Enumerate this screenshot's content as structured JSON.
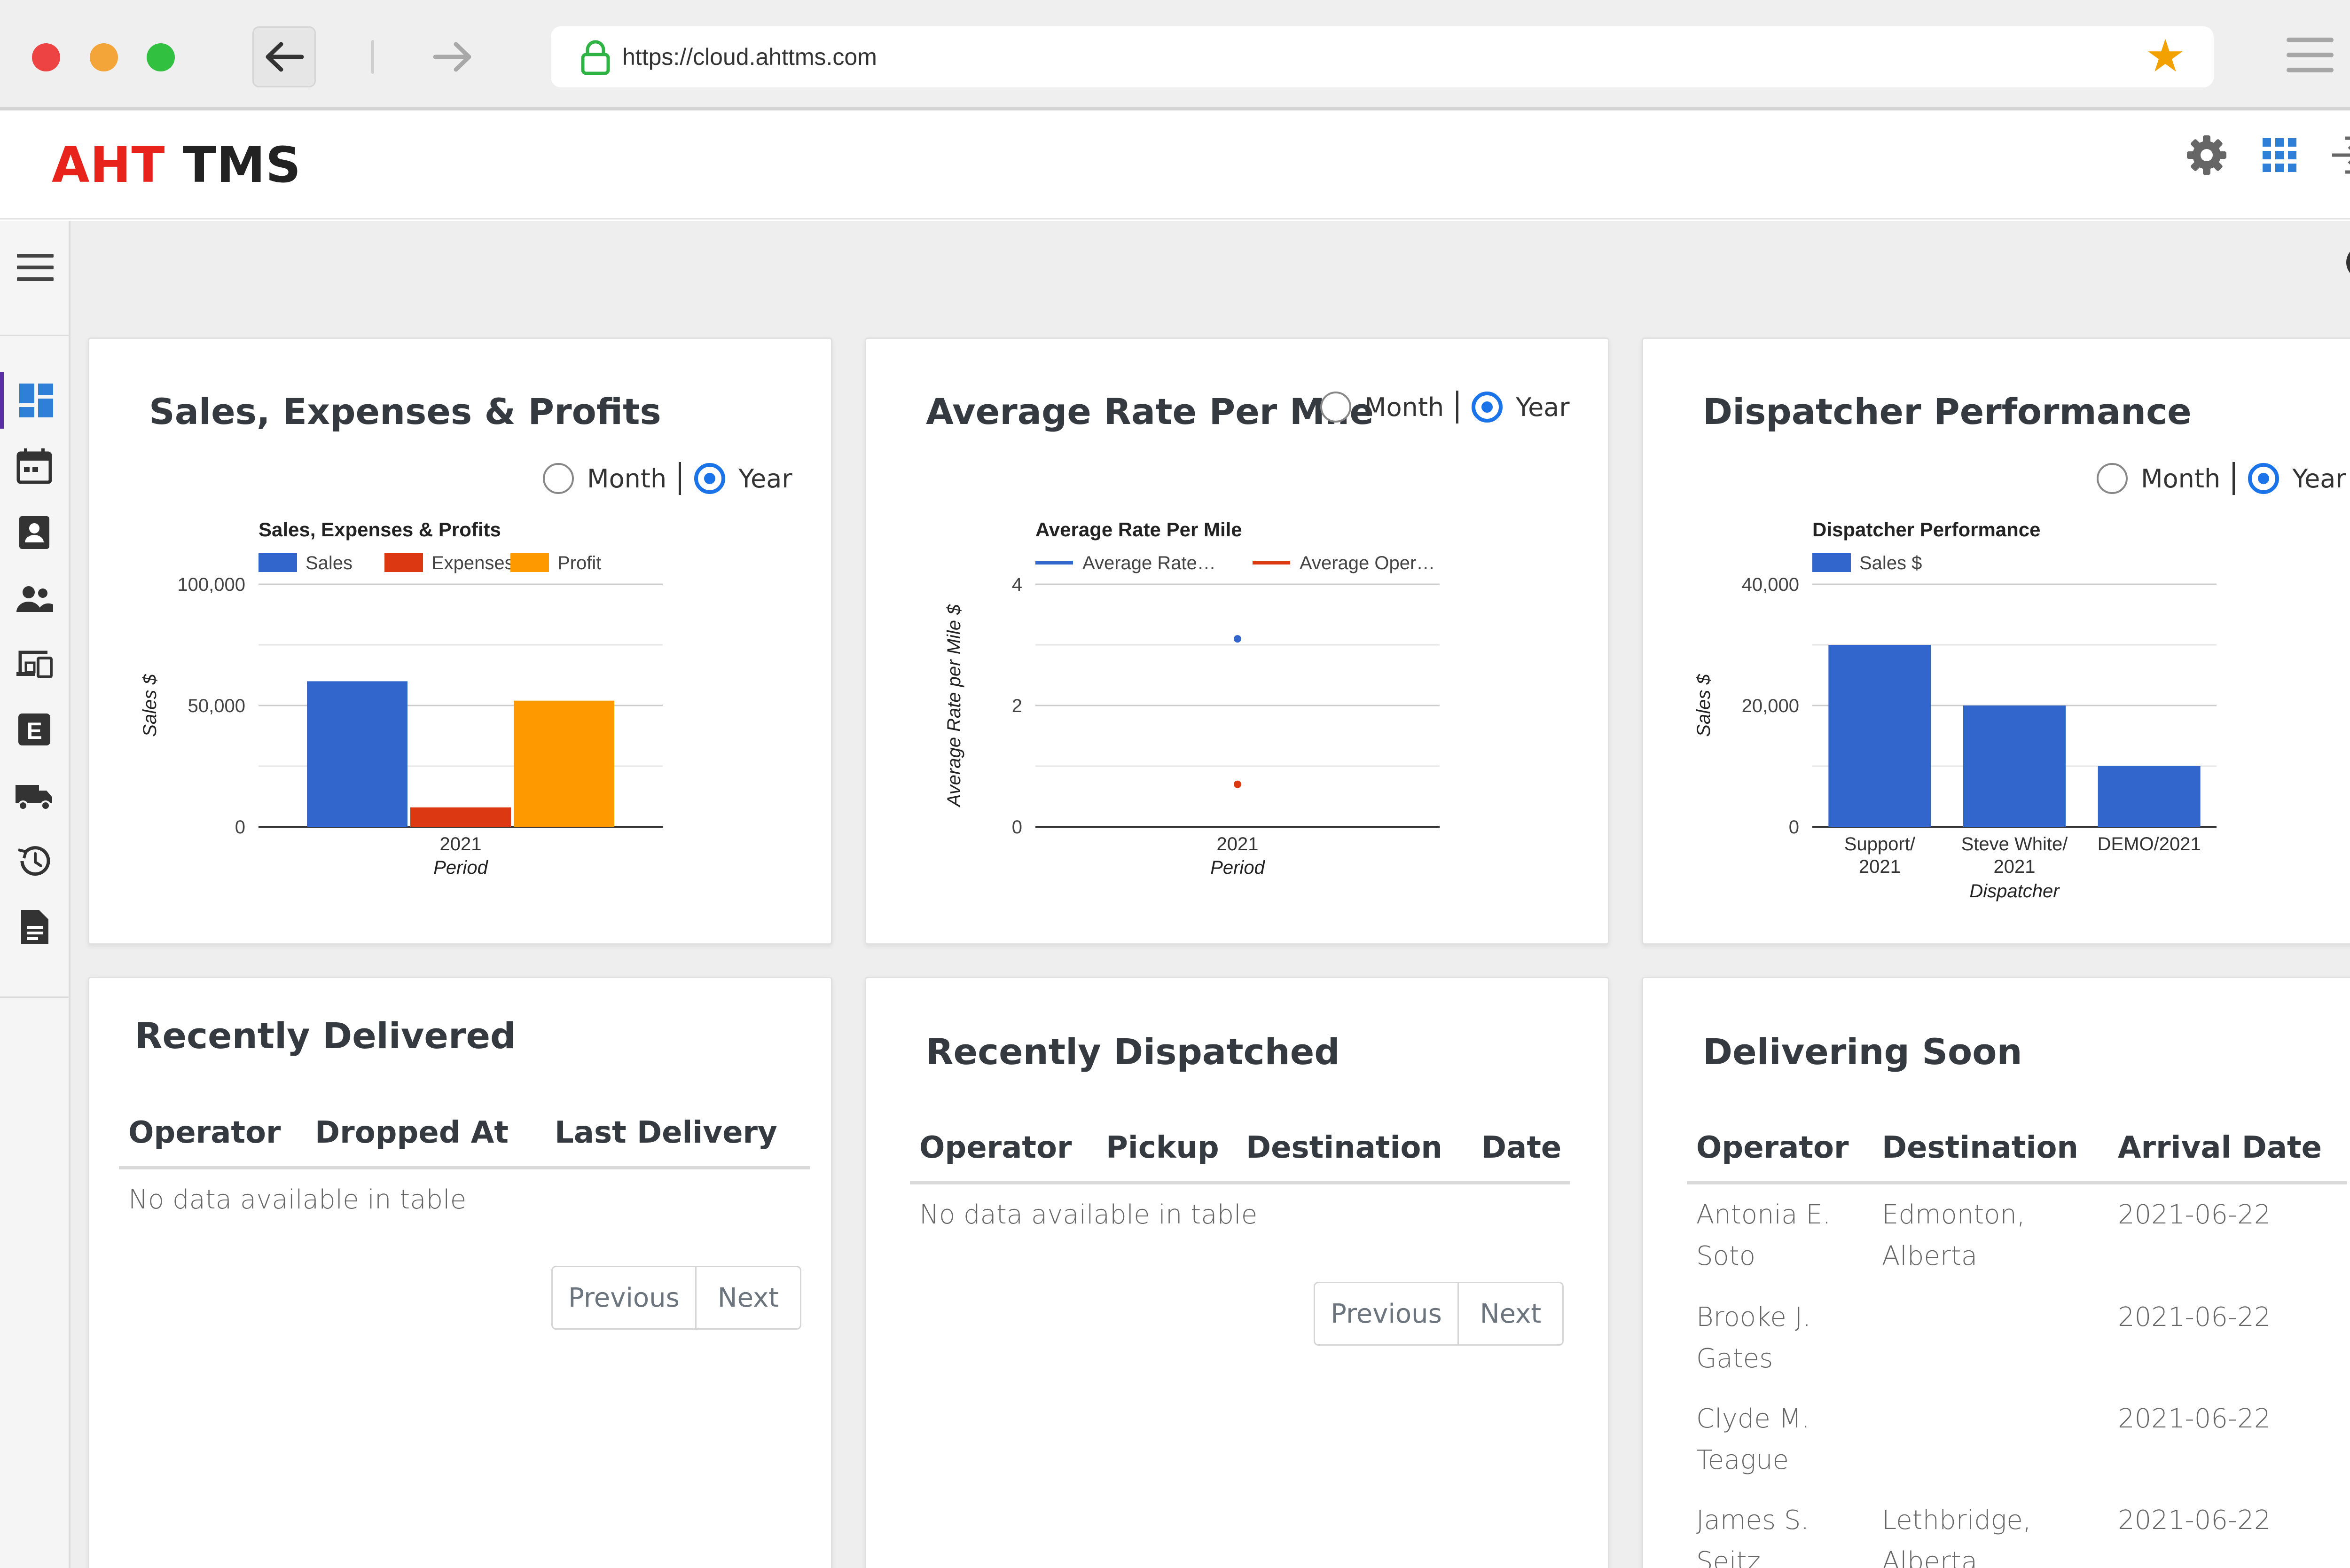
{
  "browser": {
    "url": "https://cloud.ahttms.com",
    "icons": {
      "back": "arrow-left-icon",
      "forward": "arrow-right-icon",
      "lock": "lock-icon",
      "bookmark": "star-icon",
      "menu": "hamburger-icon"
    }
  },
  "header": {
    "logo_part1": "AHT",
    "logo_part2": "TMS",
    "icons": [
      "gear-icon",
      "apps-grid-icon",
      "logout-icon"
    ]
  },
  "sidebar": {
    "items": [
      {
        "icon": "dashboard-icon",
        "active": true
      },
      {
        "icon": "calendar-icon"
      },
      {
        "icon": "contact-card-icon"
      },
      {
        "icon": "people-icon"
      },
      {
        "icon": "devices-icon"
      },
      {
        "icon": "letter-e-icon"
      },
      {
        "icon": "truck-icon"
      },
      {
        "icon": "history-icon"
      },
      {
        "icon": "document-icon"
      }
    ]
  },
  "cards": {
    "sales": {
      "title": "Sales, Expenses & Profits",
      "radio_month": "Month",
      "radio_year": "Year",
      "selected": "Year"
    },
    "rate": {
      "title": "Average Rate Per Mile",
      "radio_month": "Month",
      "radio_year": "Year",
      "selected": "Year"
    },
    "dispatcher": {
      "title": "Dispatcher Performance",
      "radio_month": "Month",
      "radio_year": "Year",
      "selected": "Year"
    },
    "delivered": {
      "title": "Recently Delivered",
      "columns": [
        "Operator",
        "Dropped At",
        "Last Delivery"
      ],
      "empty": "No data available in table",
      "prev": "Previous",
      "next": "Next"
    },
    "dispatched": {
      "title": "Recently Dispatched",
      "columns": [
        "Operator",
        "Pickup",
        "Destination",
        "Date"
      ],
      "empty": "No data available in table",
      "prev": "Previous",
      "next": "Next"
    },
    "soon": {
      "title": "Delivering Soon",
      "columns": [
        "Operator",
        "Destination",
        "Arrival Date"
      ],
      "rows": [
        {
          "operator": "Antonia E. Soto",
          "destination": "Edmonton, Alberta",
          "date": "2021-06-22"
        },
        {
          "operator": "Brooke J. Gates",
          "destination": "",
          "date": "2021-06-22"
        },
        {
          "operator": "Clyde M. Teague",
          "destination": "",
          "date": "2021-06-22"
        },
        {
          "operator": "James S. Seitz",
          "destination": "Lethbridge, Alberta",
          "date": "2021-06-22"
        }
      ]
    }
  },
  "chart_data": [
    {
      "type": "bar",
      "title": "Sales, Expenses & Profits",
      "categories": [
        "2021"
      ],
      "series": [
        {
          "name": "Sales",
          "values": [
            60000
          ],
          "color": "#3366cc"
        },
        {
          "name": "Expenses",
          "values": [
            8000
          ],
          "color": "#dc3912"
        },
        {
          "name": "Profit",
          "values": [
            52000
          ],
          "color": "#ff9900"
        }
      ],
      "xlabel": "Period",
      "ylabel": "Sales $",
      "ylim": [
        0,
        100000
      ],
      "yticks": [
        "0",
        "50,000",
        "100,000"
      ],
      "legend": "top"
    },
    {
      "type": "scatter",
      "title": "Average Rate Per Mile",
      "categories": [
        "2021"
      ],
      "series": [
        {
          "name": "Average Rate…",
          "values": [
            3.1
          ],
          "color": "#3366cc"
        },
        {
          "name": "Average Oper…",
          "values": [
            0.7
          ],
          "color": "#dc3912"
        }
      ],
      "xlabel": "Period",
      "ylabel": "Average Rate per Mile $",
      "ylim": [
        0,
        4
      ],
      "yticks": [
        "0",
        "2",
        "4"
      ],
      "legend": "top"
    },
    {
      "type": "bar",
      "title": "Dispatcher Performance",
      "categories": [
        "Support/ 2021",
        "Steve White/ 2021",
        "DEMO/2021"
      ],
      "series": [
        {
          "name": "Sales $",
          "values": [
            30000,
            20000,
            10000
          ],
          "color": "#3366cc"
        }
      ],
      "xlabel": "Dispatcher",
      "ylabel": "Sales $",
      "ylim": [
        0,
        40000
      ],
      "yticks": [
        "0",
        "20,000",
        "40,000"
      ],
      "legend": "top"
    }
  ]
}
